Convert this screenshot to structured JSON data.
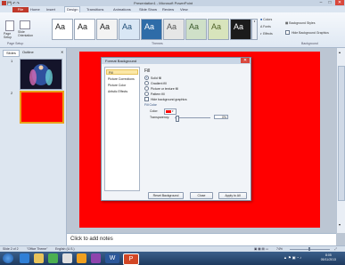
{
  "window": {
    "title": "Presentation1 - Microsoft PowerPoint",
    "controls": [
      "–",
      "□",
      "✕"
    ]
  },
  "tabs": [
    "File",
    "Home",
    "Insert",
    "Design",
    "Transitions",
    "Animations",
    "Slide Show",
    "Review",
    "View"
  ],
  "active_tab": "Design",
  "ribbon": {
    "page_setup": [
      "Page Setup",
      "Slide Orientation"
    ],
    "page_setup_group": "Page Setup",
    "themes_group": "Themes",
    "theme_label": "Aa",
    "colors": "Colors",
    "fonts": "Fonts",
    "effects": "Effects",
    "background_styles": "Background Styles",
    "hide_background": "Hide Background Graphics",
    "background_group": "Background"
  },
  "left_panel": {
    "tabs": [
      "Slides",
      "Outline"
    ],
    "slide_numbers": [
      "1",
      "2"
    ]
  },
  "dialog": {
    "title": "Format Background",
    "close": "✕",
    "sidebar": [
      "Fill",
      "Picture Corrections",
      "Picture Color",
      "Artistic Effects"
    ],
    "section_title": "Fill",
    "options": [
      {
        "label": "Solid fill",
        "checked": true
      },
      {
        "label": "Gradient fill",
        "checked": false
      },
      {
        "label": "Picture or texture fill",
        "checked": false
      },
      {
        "label": "Pattern fill",
        "checked": false
      }
    ],
    "hide_graphics": "Hide background graphics",
    "fill_color_label": "Fill Color",
    "color_label": "Color:",
    "transparency_label": "Transparency:",
    "transparency_value": "0%",
    "buttons": [
      "Reset Background",
      "Close",
      "Apply to All"
    ]
  },
  "notes_placeholder": "Click to add notes",
  "status": {
    "slide": "Slide 2 of 2",
    "theme": "\"Office Theme\"",
    "language": "English (U.S.)",
    "zoom": "74%"
  },
  "taskbar": {
    "time": "8:05",
    "date": "05/11/2013"
  },
  "colors": {
    "slide_bg": "#ff0000",
    "file_tab": "#c0392b"
  }
}
